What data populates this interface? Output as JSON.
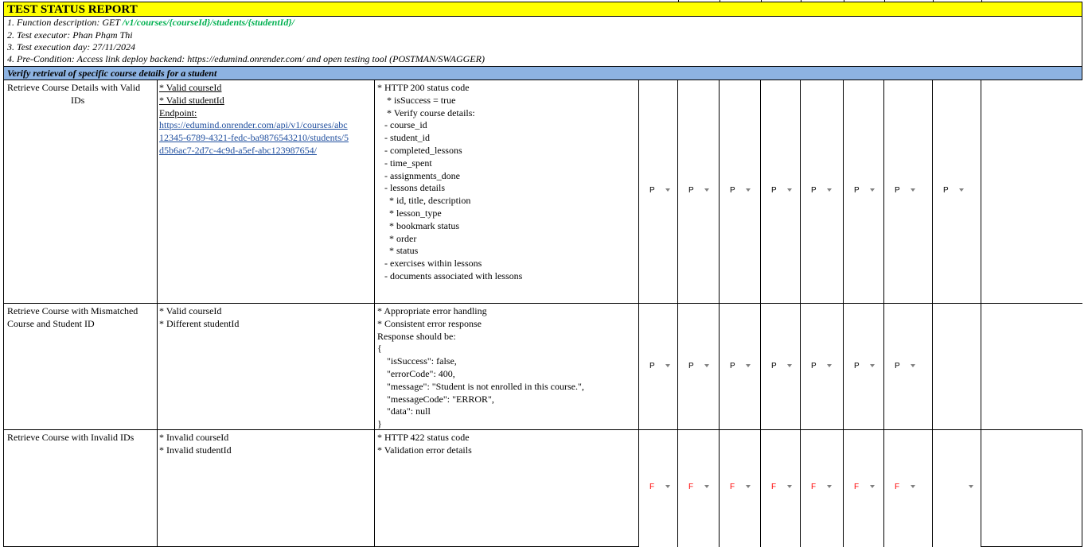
{
  "report": {
    "title": "TEST STATUS REPORT",
    "function_prefix": "1. Function description: GET ",
    "function_path": "/v1/courses/{courseId}/students/{studentId}/",
    "executor": "2. Test executor:  Phan Phạm Thi",
    "execution_day": "3. Test execution day: 27/11/2024",
    "precondition": "4. Pre-Condition: Access link deploy backend: https://edumind.onrender.com/  and open testing tool (POSTMAN/SWAGGER)",
    "section": "Verify retrieval of specific course details for a student"
  },
  "rows": [
    {
      "name_line1": "Retrieve Course Details with Valid",
      "name_line2": "IDs",
      "input_1": "* Valid courseId",
      "input_2": "* Valid studentId",
      "endpoint_label": "Endpoint:",
      "endpoint_url_1": "https://edumind.onrender.com/api/v1/courses/abc",
      "endpoint_url_2": "12345-6789-4321-fedc-ba9876543210/students/5",
      "endpoint_url_3": "d5b6ac7-2d7c-4c9d-a5ef-abc123987654/",
      "expected": "* HTTP 200 status code\n    * isSuccess = true\n    * Verify course details:\n   - course_id\n   - student_id\n   - completed_lessons\n   - time_spent\n   - assignments_done\n   - lessons details\n     * id, title, description\n     * lesson_type\n     * bookmark status\n     * order\n     * status\n   - exercises within lessons\n   - documents associated with lessons",
      "results": [
        "P",
        "P",
        "P",
        "P",
        "P",
        "P",
        "P",
        "P"
      ]
    },
    {
      "name_line1": "Retrieve Course with Mismatched",
      "name_line2": "Course and Student ID",
      "input_1": "* Valid courseId",
      "input_2": "* Different studentId",
      "expected": "* Appropriate error handling\n* Consistent error response\nResponse should be:\n{\n    \"isSuccess\": false,\n    \"errorCode\": 400,\n    \"message\": \"Student is not enrolled in this course.\",\n    \"messageCode\": \"ERROR\",\n    \"data\": null\n}",
      "results": [
        "P",
        "P",
        "P",
        "P",
        "P",
        "P",
        "P",
        ""
      ]
    },
    {
      "name_line1": "Retrieve Course with Invalid IDs",
      "name_line2": "",
      "input_1": "* Invalid courseId",
      "input_2": "* Invalid studentId",
      "expected": "* HTTP 422 status code\n* Validation error details",
      "results": [
        "F",
        "F",
        "F",
        "F",
        "F",
        "F",
        "F",
        ""
      ]
    }
  ],
  "colors": {
    "title_bg": "#ffff00",
    "section_bg": "#8db3e2",
    "path_green": "#00b050",
    "fail_red": "#ff0000"
  }
}
